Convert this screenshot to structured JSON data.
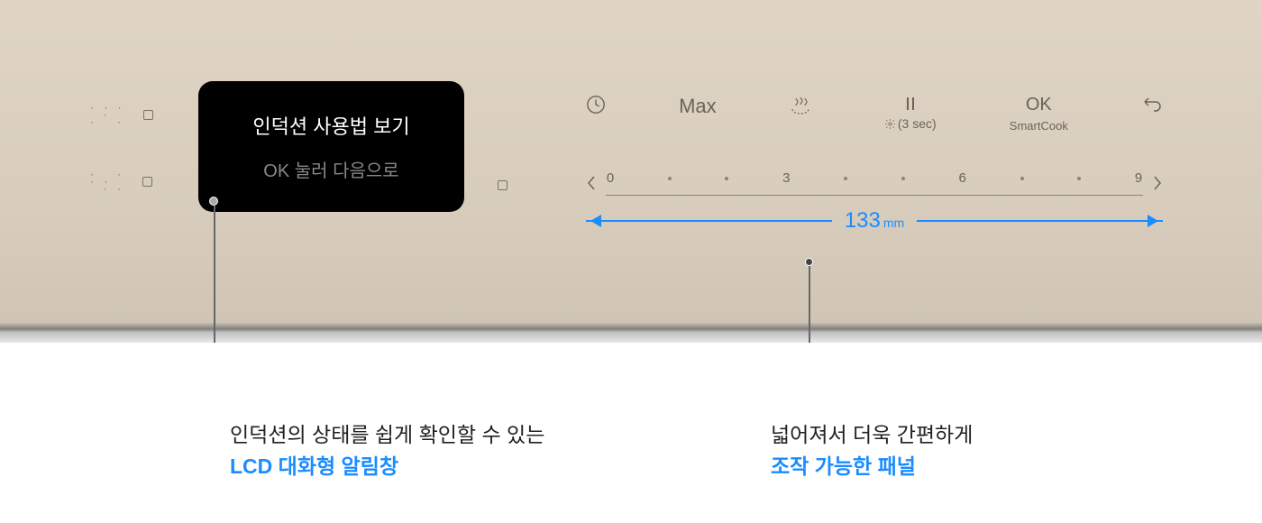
{
  "lcd": {
    "title": "인덕션 사용법 보기",
    "subtitle": "OK 눌러 다음으로"
  },
  "controls": {
    "max": "Max",
    "pause_sub_prefix": "(3 sec)",
    "ok": "OK",
    "smartcook": "SmartCook"
  },
  "slider": {
    "marks": [
      "0",
      "·",
      "·",
      "3",
      "·",
      "·",
      "6",
      "·",
      "·",
      "9"
    ]
  },
  "measure": {
    "value": "133",
    "unit": "mm"
  },
  "captions": {
    "left_line1": "인덕션의 상태를 쉽게 확인할 수 있는",
    "left_line2": "LCD 대화형 알림창",
    "right_line1": "넓어져서 더욱 간편하게",
    "right_line2": "조작 가능한 패널"
  }
}
